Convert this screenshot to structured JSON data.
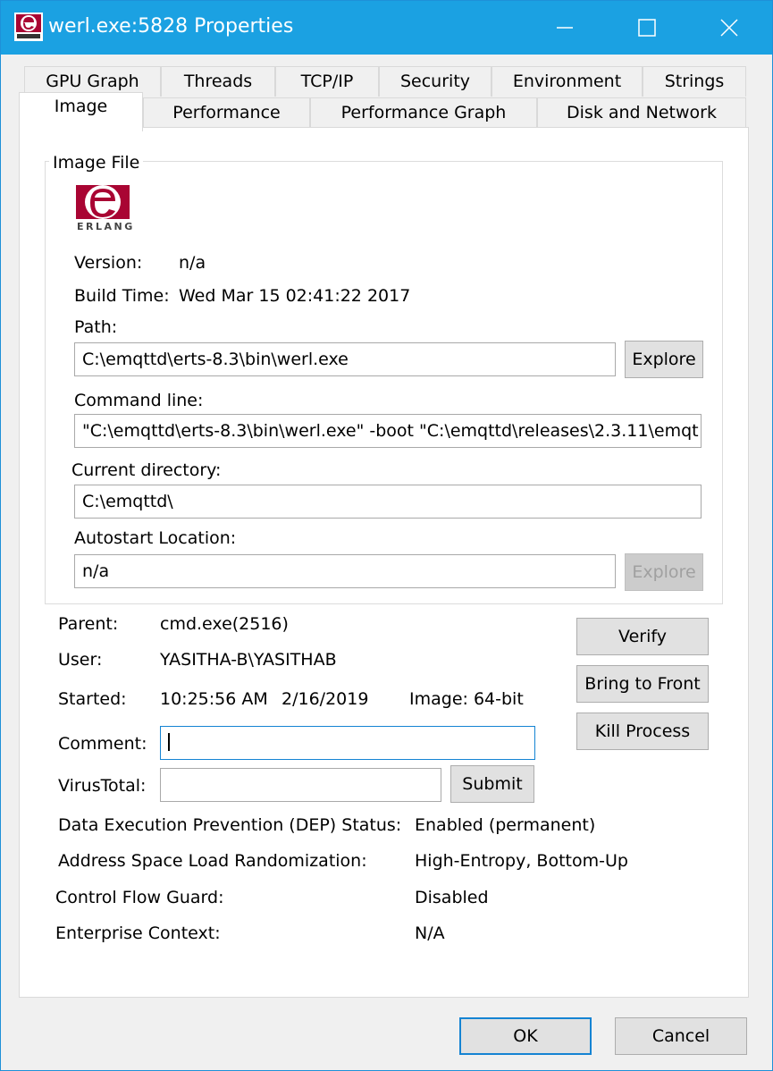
{
  "window": {
    "title": "werl.exe:5828 Properties",
    "accent": "#1ba1e2"
  },
  "tabs_row1": [
    "GPU Graph",
    "Threads",
    "TCP/IP",
    "Security",
    "Environment",
    "Strings"
  ],
  "tabs_row2": [
    "Image",
    "Performance",
    "Performance Graph",
    "Disk and Network"
  ],
  "active_tab": "Image",
  "image_file": {
    "group_title": "Image File",
    "logo_text": "ERLANG",
    "version_label": "Version:",
    "version_value": "n/a",
    "build_time_label": "Build Time:",
    "build_time_value": "Wed Mar 15 02:41:22 2017",
    "path_label": "Path:",
    "path_value": "C:\\emqttd\\erts-8.3\\bin\\werl.exe",
    "explore_label": "Explore",
    "command_line_label": "Command line:",
    "command_line_value": "\"C:\\emqttd\\erts-8.3\\bin\\werl.exe\"  -boot \"C:\\emqttd\\releases\\2.3.11\\emqt",
    "current_dir_label": "Current directory:",
    "current_dir_value": "C:\\emqttd\\",
    "autostart_label": "Autostart Location:",
    "autostart_value": "n/a",
    "autostart_explore_label": "Explore"
  },
  "process": {
    "parent_label": "Parent:",
    "parent_value": "cmd.exe(2516)",
    "user_label": "User:",
    "user_value": "YASITHA-B\\YASITHAB",
    "started_label": "Started:",
    "started_time": "10:25:56 AM",
    "started_date": "2/16/2019",
    "image_bits": "Image: 64-bit",
    "comment_label": "Comment:",
    "comment_value": "",
    "virustotal_label": "VirusTotal:",
    "virustotal_value": "",
    "submit_label": "Submit",
    "verify_label": "Verify",
    "bring_front_label": "Bring to Front",
    "kill_label": "Kill Process"
  },
  "security": {
    "dep_label": "Data Execution Prevention (DEP) Status:",
    "dep_value": "Enabled (permanent)",
    "aslr_label": "Address Space Load Randomization:",
    "aslr_value": "High-Entropy, Bottom-Up",
    "cfg_label": "Control Flow Guard:",
    "cfg_value": "Disabled",
    "enterprise_label": "Enterprise Context:",
    "enterprise_value": "N/A"
  },
  "footer": {
    "ok_label": "OK",
    "cancel_label": "Cancel"
  }
}
